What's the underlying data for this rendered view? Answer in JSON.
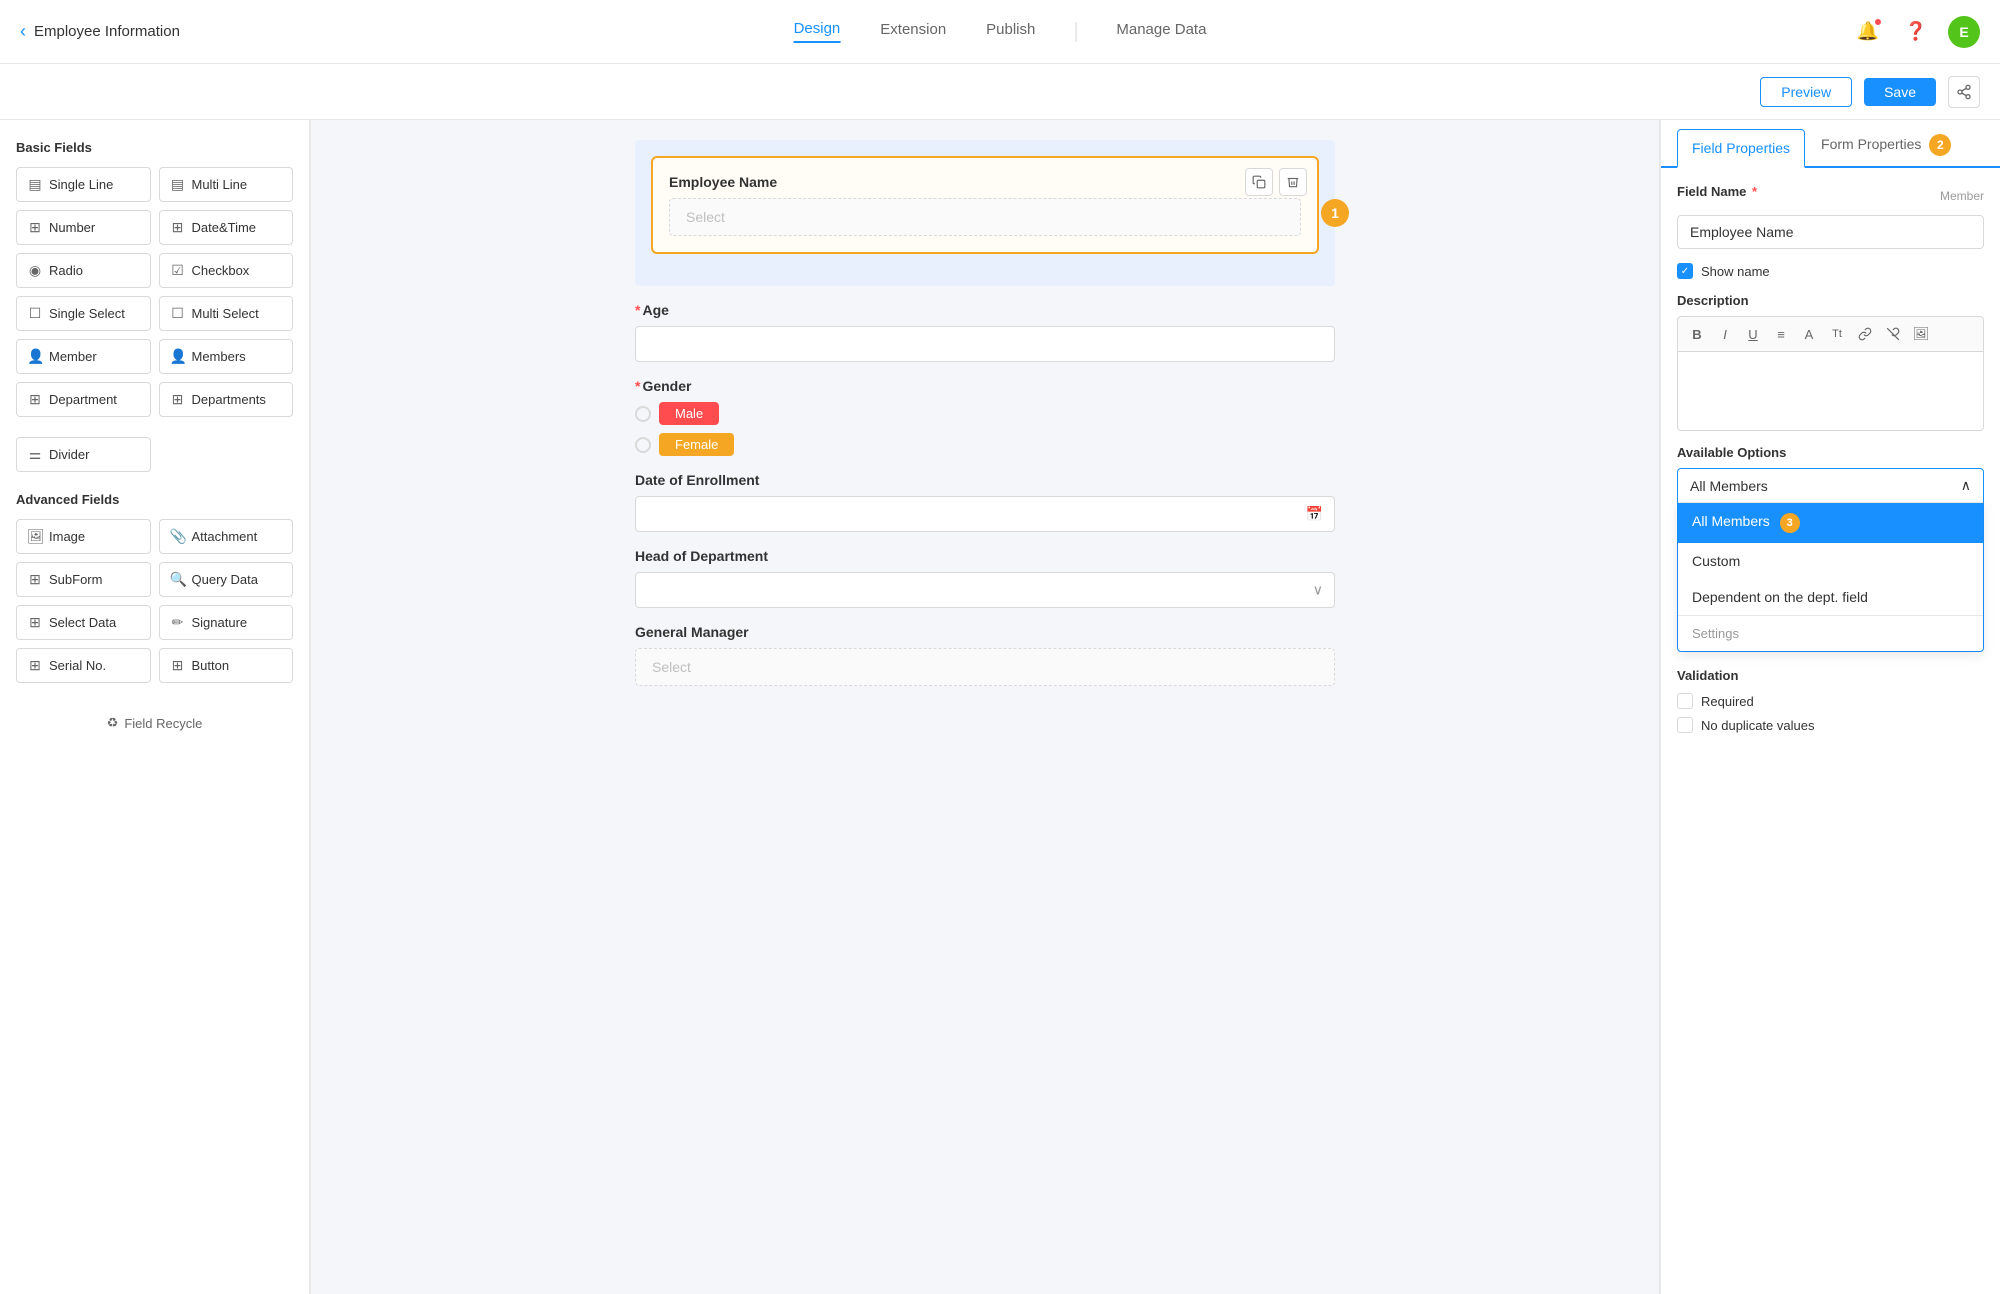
{
  "nav": {
    "back_icon": "‹",
    "title": "Employee Information",
    "tabs": [
      "Design",
      "Extension",
      "Publish"
    ],
    "manage_data": "Manage Data",
    "active_tab": "Design"
  },
  "toolbar": {
    "preview_label": "Preview",
    "save_label": "Save",
    "share_icon": "⬡"
  },
  "left_panel": {
    "basic_title": "Basic Fields",
    "basic_fields": [
      {
        "id": "single-line",
        "label": "Single Line",
        "icon": "▤"
      },
      {
        "id": "multi-line",
        "label": "Multi Line",
        "icon": "▤"
      },
      {
        "id": "number",
        "label": "Number",
        "icon": "⊞"
      },
      {
        "id": "datetime",
        "label": "Date&Time",
        "icon": "⊞"
      },
      {
        "id": "radio",
        "label": "Radio",
        "icon": "◉"
      },
      {
        "id": "checkbox",
        "label": "Checkbox",
        "icon": "☑"
      },
      {
        "id": "single-select",
        "label": "Single Select",
        "icon": "☐"
      },
      {
        "id": "multi-select",
        "label": "Multi Select",
        "icon": "☐"
      },
      {
        "id": "member",
        "label": "Member",
        "icon": "👤"
      },
      {
        "id": "members",
        "label": "Members",
        "icon": "👤"
      },
      {
        "id": "department",
        "label": "Department",
        "icon": "⊞"
      },
      {
        "id": "departments",
        "label": "Departments",
        "icon": "⊞"
      }
    ],
    "divider_label": "Divider",
    "advanced_title": "Advanced Fields",
    "advanced_fields": [
      {
        "id": "image",
        "label": "Image",
        "icon": "🖼"
      },
      {
        "id": "attachment",
        "label": "Attachment",
        "icon": "📎"
      },
      {
        "id": "subform",
        "label": "SubForm",
        "icon": "⊞"
      },
      {
        "id": "query-data",
        "label": "Query Data",
        "icon": "🔍"
      },
      {
        "id": "select-data",
        "label": "Select Data",
        "icon": "⊞"
      },
      {
        "id": "signature",
        "label": "Signature",
        "icon": "✏"
      },
      {
        "id": "serial-no",
        "label": "Serial No.",
        "icon": "⊞"
      },
      {
        "id": "button",
        "label": "Button",
        "icon": "⊞"
      }
    ],
    "recycle_label": "Field Recycle"
  },
  "form": {
    "employee_name_label": "Employee Name",
    "employee_name_placeholder": "Select",
    "age_label": "Age",
    "age_required": true,
    "gender_label": "Gender",
    "gender_required": true,
    "gender_options": [
      {
        "value": "male",
        "label": "Male",
        "color": "#ff4d4f"
      },
      {
        "value": "female",
        "label": "Female",
        "color": "#f5a623"
      }
    ],
    "enrollment_label": "Date of Enrollment",
    "dept_head_label": "Head of Department",
    "general_manager_label": "General Manager",
    "general_manager_placeholder": "Select"
  },
  "right_panel": {
    "field_props_label": "Field Properties",
    "form_props_label": "Form Properties",
    "field_name_label": "Field Name",
    "field_name_required": true,
    "member_tag": "Member",
    "field_name_value": "Employee Name",
    "show_name_label": "Show name",
    "description_label": "Description",
    "desc_tools": [
      "B",
      "I",
      "U",
      "≡",
      "A",
      "Tt",
      "🔗",
      "⛓",
      "🖼"
    ],
    "available_options_label": "Available Options",
    "dropdown_selected": "All Members",
    "dropdown_options": [
      {
        "label": "All Members",
        "selected": true,
        "badge": true
      },
      {
        "label": "Custom",
        "selected": false
      },
      {
        "label": "Dependent on the dept. field",
        "selected": false
      }
    ],
    "settings_label": "Settings",
    "validation_label": "Validation",
    "required_label": "Required",
    "no_duplicate_label": "No duplicate values"
  },
  "badges": {
    "step1": "1",
    "step2": "2",
    "step3": "3"
  }
}
